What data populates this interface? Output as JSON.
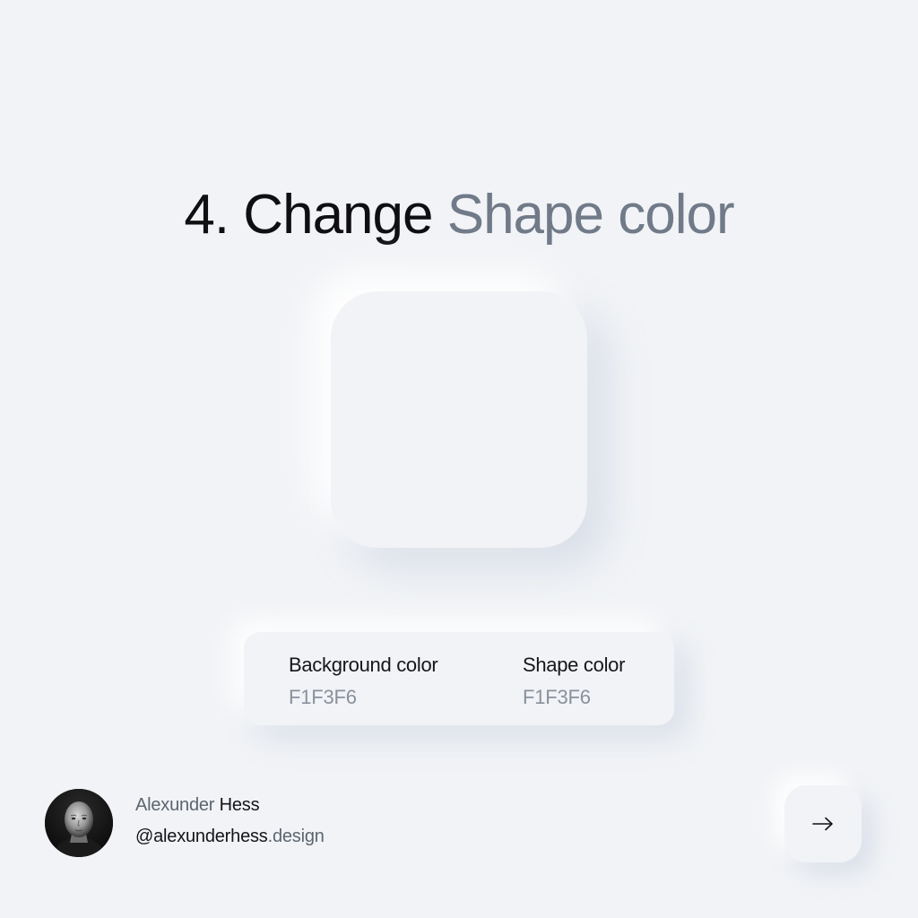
{
  "title": {
    "prefix": "4. Change ",
    "highlight": "Shape color"
  },
  "info_card": {
    "background": {
      "label": "Background color",
      "value": "F1F3F6"
    },
    "shape": {
      "label": "Shape color",
      "value": "F1F3F6"
    }
  },
  "author": {
    "first_name": "Alexunder",
    "last_name": "Hess",
    "handle": "@alexunderhess",
    "handle_suffix": ".design"
  },
  "next_button": {
    "icon": "arrow-right-icon"
  },
  "colors": {
    "background": "#F1F3F6",
    "shape": "#F1F3F6",
    "title_dark": "#0F0F12",
    "title_muted": "#707A88"
  }
}
